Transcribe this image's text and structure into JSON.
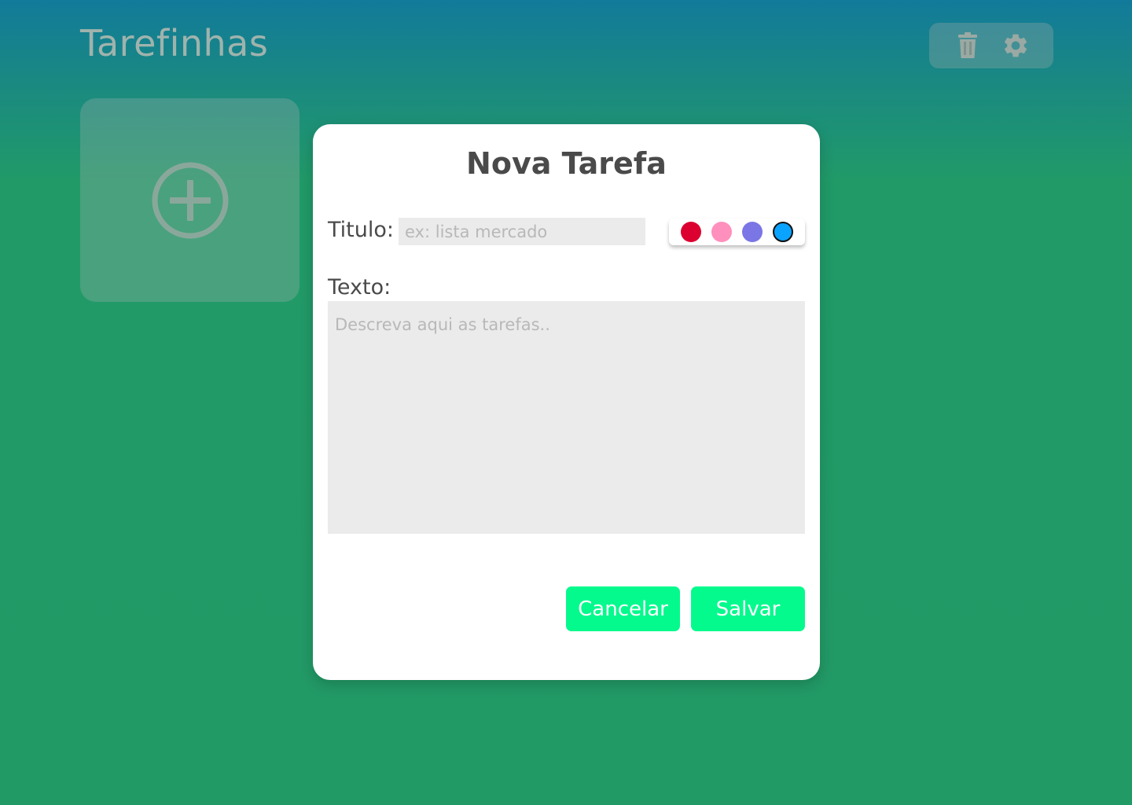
{
  "header": {
    "title": "Tarefinhas",
    "actions": [
      {
        "icon": "trash-icon"
      },
      {
        "icon": "gear-icon"
      }
    ]
  },
  "add_card": {
    "icon": "plus-circle-icon"
  },
  "modal": {
    "title": "Nova Tarefa",
    "title_label": "Titulo:",
    "title_placeholder": "ex: lista mercado",
    "title_value": "",
    "text_label": "Texto:",
    "text_placeholder": "Descreva aqui as tarefas..",
    "text_value": "",
    "colors": [
      {
        "hex": "#dc0030",
        "selected": false
      },
      {
        "hex": "#ff8fbd",
        "selected": false
      },
      {
        "hex": "#7a76e6",
        "selected": false
      },
      {
        "hex": "#0aa3ff",
        "selected": true
      }
    ],
    "cancel_label": "Cancelar",
    "save_label": "Salvar"
  },
  "theme": {
    "accent": "#05fa8d",
    "background_top": "#127a9a",
    "background_bottom": "#229a66"
  }
}
